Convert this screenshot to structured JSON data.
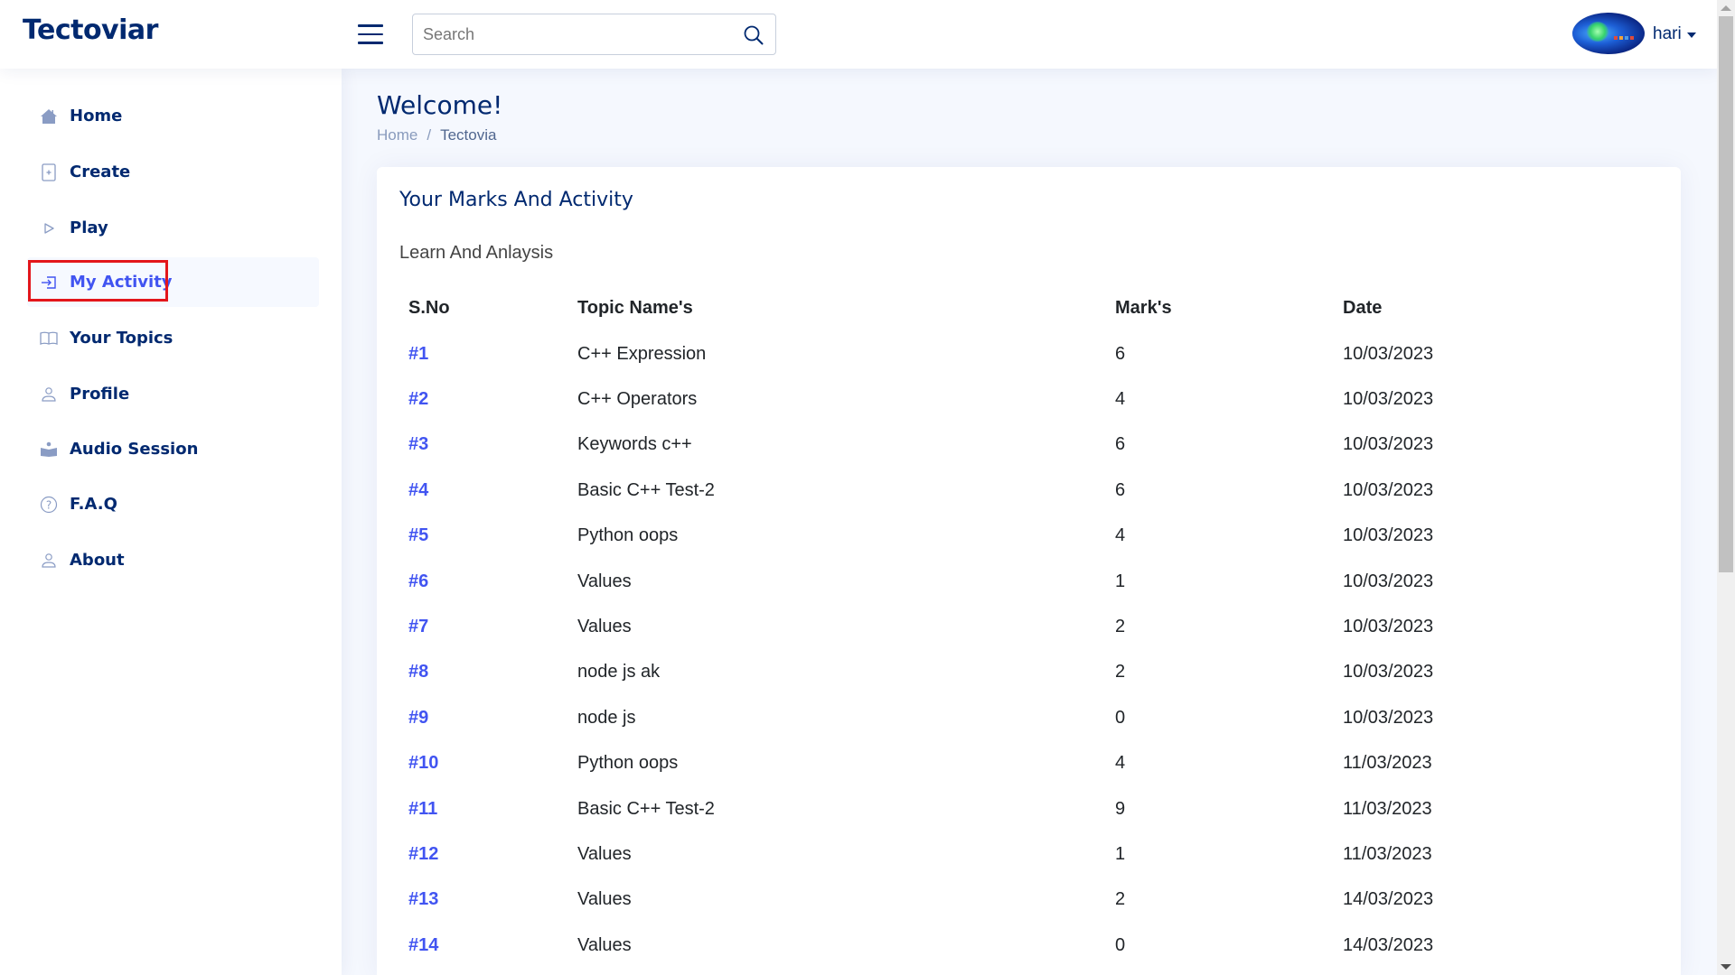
{
  "header": {
    "logo": "Tectoviar",
    "search": {
      "placeholder": "Search",
      "value": ""
    },
    "user": {
      "name": "hari"
    }
  },
  "sidebar": {
    "items": [
      {
        "label": "Home",
        "icon": "house-icon",
        "active": false
      },
      {
        "label": "Create",
        "icon": "plus-square-icon",
        "active": false
      },
      {
        "label": "Play",
        "icon": "play-icon",
        "active": false
      },
      {
        "label": "My Activity",
        "icon": "box-arrow-in-right-icon",
        "active": true
      },
      {
        "label": "Your Topics",
        "icon": "book-icon",
        "active": false
      },
      {
        "label": "Profile",
        "icon": "person-icon",
        "active": false
      },
      {
        "label": "Audio Session",
        "icon": "reader-icon",
        "active": false
      },
      {
        "label": "F.A.Q",
        "icon": "question-circle-icon",
        "active": false
      },
      {
        "label": "About",
        "icon": "person-icon",
        "active": false
      }
    ]
  },
  "page": {
    "title": "Welcome!",
    "breadcrumb": {
      "home": "Home",
      "separator": "/",
      "current": "Tectovia"
    }
  },
  "card": {
    "title": "Your Marks And Activity",
    "subtitle": "Learn And Anlaysis",
    "table": {
      "headers": [
        "S.No",
        "Topic Name's",
        "Mark's",
        "Date"
      ],
      "rows": [
        {
          "sno": "#1",
          "topic": "C++ Expression",
          "marks": "6",
          "date": "10/03/2023"
        },
        {
          "sno": "#2",
          "topic": "C++ Operators",
          "marks": "4",
          "date": "10/03/2023"
        },
        {
          "sno": "#3",
          "topic": "Keywords c++",
          "marks": "6",
          "date": "10/03/2023"
        },
        {
          "sno": "#4",
          "topic": "Basic C++ Test-2",
          "marks": "6",
          "date": "10/03/2023"
        },
        {
          "sno": "#5",
          "topic": "Python oops",
          "marks": "4",
          "date": "10/03/2023"
        },
        {
          "sno": "#6",
          "topic": "Values",
          "marks": "1",
          "date": "10/03/2023"
        },
        {
          "sno": "#7",
          "topic": "Values",
          "marks": "2",
          "date": "10/03/2023"
        },
        {
          "sno": "#8",
          "topic": "node js ak",
          "marks": "2",
          "date": "10/03/2023"
        },
        {
          "sno": "#9",
          "topic": "node js",
          "marks": "0",
          "date": "10/03/2023"
        },
        {
          "sno": "#10",
          "topic": "Python oops",
          "marks": "4",
          "date": "11/03/2023"
        },
        {
          "sno": "#11",
          "topic": "Basic C++ Test-2",
          "marks": "9",
          "date": "11/03/2023"
        },
        {
          "sno": "#12",
          "topic": "Values",
          "marks": "1",
          "date": "11/03/2023"
        },
        {
          "sno": "#13",
          "topic": "Values",
          "marks": "2",
          "date": "14/03/2023"
        },
        {
          "sno": "#14",
          "topic": "Values",
          "marks": "0",
          "date": "14/03/2023"
        }
      ]
    }
  },
  "colors": {
    "brand": "#012970",
    "accent": "#4154f1",
    "highlight": "#e3161b",
    "background": "#f5f8fe"
  }
}
